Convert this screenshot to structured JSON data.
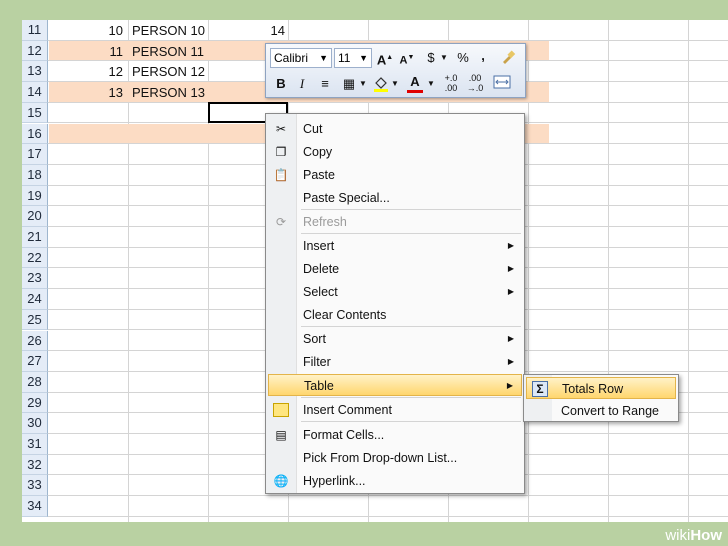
{
  "rows": [
    {
      "num": "11",
      "a": "10",
      "b": "PERSON 10",
      "c": "14"
    },
    {
      "num": "12",
      "a": "11",
      "b": "PERSON 11",
      "c": ""
    },
    {
      "num": "13",
      "a": "12",
      "b": "PERSON 12",
      "c": ""
    },
    {
      "num": "14",
      "a": "13",
      "b": "PERSON 13",
      "c": ""
    },
    {
      "num": "15",
      "a": "",
      "b": "",
      "c": ""
    },
    {
      "num": "16",
      "a": "",
      "b": "",
      "c": ""
    },
    {
      "num": "17"
    },
    {
      "num": "18"
    },
    {
      "num": "19"
    },
    {
      "num": "20"
    },
    {
      "num": "21"
    },
    {
      "num": "22"
    },
    {
      "num": "23"
    },
    {
      "num": "24"
    },
    {
      "num": "25"
    },
    {
      "num": "26"
    },
    {
      "num": "27"
    },
    {
      "num": "28"
    },
    {
      "num": "29"
    },
    {
      "num": "30"
    },
    {
      "num": "31"
    },
    {
      "num": "32"
    },
    {
      "num": "33"
    },
    {
      "num": "34"
    }
  ],
  "toolbar": {
    "font": "Calibri",
    "size": "11",
    "bold": "B",
    "italic": "I",
    "dollar": "$",
    "percent": "%",
    "comma": ","
  },
  "menu": {
    "cut": "Cut",
    "copy": "Copy",
    "paste": "Paste",
    "paste_special": "Paste Special...",
    "refresh": "Refresh",
    "insert": "Insert",
    "delete": "Delete",
    "select": "Select",
    "clear_contents": "Clear Contents",
    "sort": "Sort",
    "filter": "Filter",
    "table": "Table",
    "insert_comment": "Insert Comment",
    "format_cells": "Format Cells...",
    "pick_list": "Pick From Drop-down List...",
    "hyperlink": "Hyperlink..."
  },
  "submenu": {
    "totals_row": "Totals Row",
    "convert_range": "Convert to Range"
  },
  "brand": {
    "wiki": "wiki",
    "how": "How"
  },
  "colors": {
    "band": "#fcdcc4",
    "header": "#e4ecf7",
    "highlight": "#ffd66e",
    "background": "#b9d1a2"
  }
}
